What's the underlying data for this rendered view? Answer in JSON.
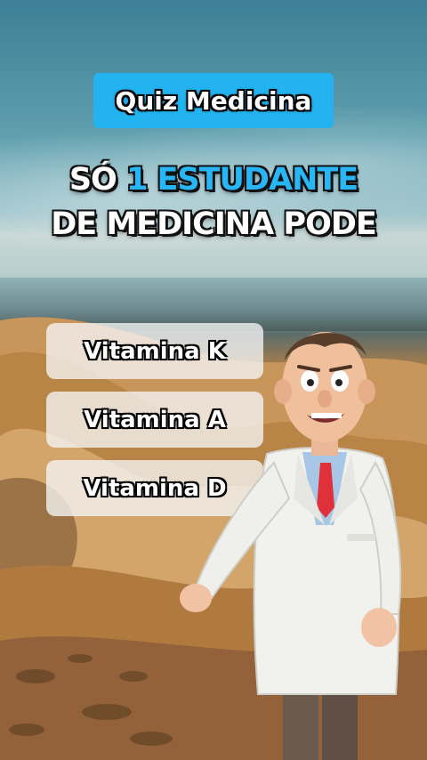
{
  "header": {
    "tag_label": "Quiz Medicina",
    "headline_line1_prefix": "SÓ ",
    "headline_line1_highlight": "1 ESTUDANTE",
    "headline_line2": "DE MEDICINA PODE"
  },
  "options": [
    {
      "label": "Vitamina K"
    },
    {
      "label": "Vitamina A"
    },
    {
      "label": "Vitamina D"
    }
  ],
  "colors": {
    "accent_blue": "#22b3f0",
    "highlight_blue": "#29b6f6",
    "option_bg": "#f5f5f5"
  },
  "icons": [
    "doctor-character-illustration"
  ]
}
